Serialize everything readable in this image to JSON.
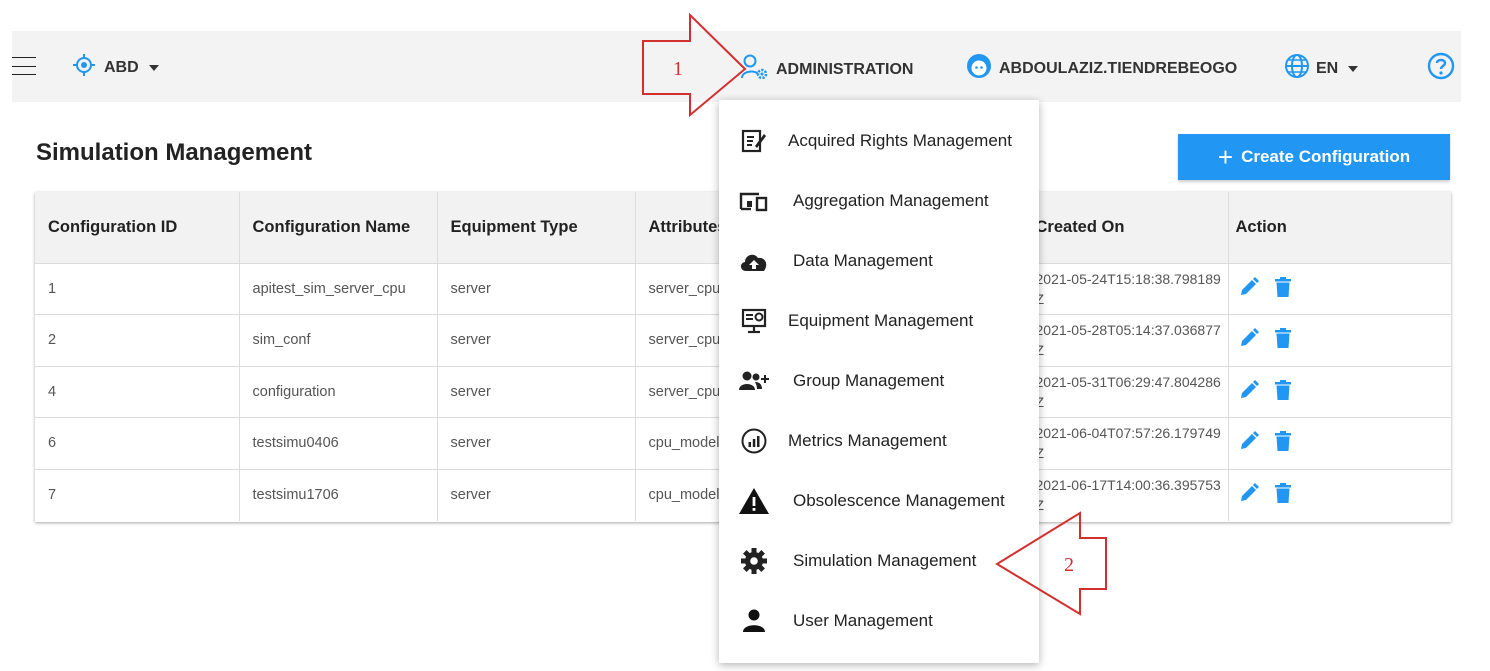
{
  "toolbar": {
    "tenant": "ABD",
    "admin_label": "ADMINISTRATION",
    "user_label": "ABDOULAZIZ.TIENDREBEOGO",
    "lang_label": "EN"
  },
  "page": {
    "title": "Simulation Management",
    "create_button": "Create Configuration"
  },
  "table": {
    "headers": [
      "Configuration ID",
      "Configuration Name",
      "Equipment Type",
      "Attributes",
      "Created On",
      "Action"
    ],
    "rows": [
      {
        "id": "1",
        "name": "apitest_sim_server_cpu",
        "type": "server",
        "attr": "server_cpu",
        "created": "2021-05-24T15:18:38.798189Z"
      },
      {
        "id": "2",
        "name": "sim_conf",
        "type": "server",
        "attr": "server_cpu",
        "created": "2021-05-28T05:14:37.036877Z"
      },
      {
        "id": "4",
        "name": "configuration",
        "type": "server",
        "attr": "server_cpu",
        "created": "2021-05-31T06:29:47.804286Z"
      },
      {
        "id": "6",
        "name": "testsimu0406",
        "type": "server",
        "attr": "cpu_model",
        "created": "2021-06-04T07:57:26.179749Z"
      },
      {
        "id": "7",
        "name": "testsimu1706",
        "type": "server",
        "attr": "cpu_model",
        "created": "2021-06-17T14:00:36.395753Z"
      }
    ]
  },
  "admin_menu": {
    "items": [
      {
        "label": "Acquired Rights Management",
        "icon": "document-edit-icon"
      },
      {
        "label": "Aggregation Management",
        "icon": "devices-icon"
      },
      {
        "label": "Data Management",
        "icon": "cloud-upload-icon"
      },
      {
        "label": "Equipment Management",
        "icon": "monitor-settings-icon"
      },
      {
        "label": "Group Management",
        "icon": "group-add-icon"
      },
      {
        "label": "Metrics Management",
        "icon": "chart-circle-icon"
      },
      {
        "label": "Obsolescence Management",
        "icon": "warning-icon"
      },
      {
        "label": "Simulation Management",
        "icon": "gear-icon"
      },
      {
        "label": "User Management",
        "icon": "person-icon"
      }
    ]
  },
  "annotations": {
    "step1": "1",
    "step2": "2"
  },
  "colors": {
    "accent": "#2196f3",
    "annotation": "#d32f2f"
  }
}
